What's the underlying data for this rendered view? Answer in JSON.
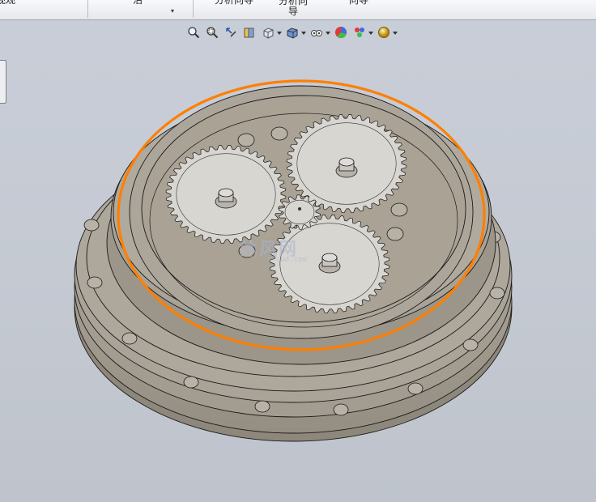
{
  "ribbon": {
    "tabs": [
      {
        "label": "视观"
      },
      {
        "label": "沼"
      },
      {
        "label": "分析向导"
      },
      {
        "label": "分析向导"
      },
      {
        "label": "向导"
      }
    ]
  },
  "view_toolbar": {
    "buttons": [
      {
        "icon": "zoom-to-fit-icon"
      },
      {
        "icon": "zoom-to-area-icon"
      },
      {
        "icon": "previous-view-icon"
      },
      {
        "icon": "section-view-icon"
      },
      {
        "icon": "view-orientation-icon"
      },
      {
        "icon": "display-style-icon"
      },
      {
        "icon": "hide-show-items-icon"
      },
      {
        "icon": "edit-appearance-icon"
      },
      {
        "icon": "apply-scene-icon"
      },
      {
        "icon": "view-settings-icon"
      }
    ]
  },
  "watermark": {
    "text": "沐风网",
    "url": "mfcad.com"
  },
  "colors": {
    "viewport_bg": "#c6cbd4",
    "part_fill": "#ada69a",
    "gear_fill": "#d8d6d1",
    "highlight": "#ff7f00"
  }
}
